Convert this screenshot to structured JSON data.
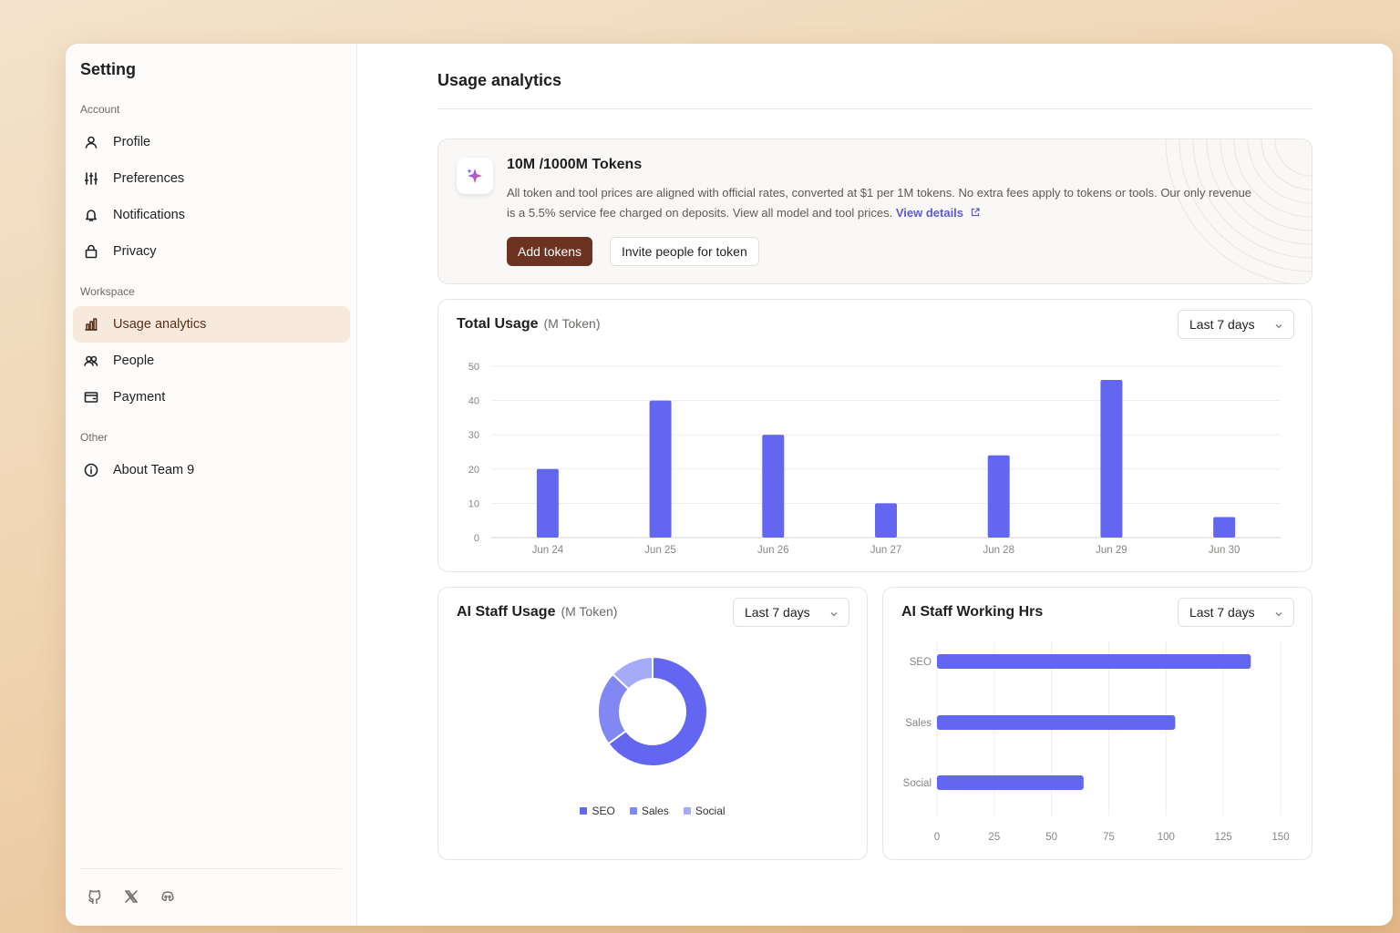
{
  "sidebar": {
    "title": "Setting",
    "sections": {
      "account": "Account",
      "workspace": "Workspace",
      "other": "Other"
    },
    "items": {
      "profile": "Profile",
      "preferences": "Preferences",
      "notifications": "Notifications",
      "privacy": "Privacy",
      "usage": "Usage analytics",
      "people": "People",
      "payment": "Payment",
      "about": "About Team 9"
    },
    "active_item": "Usage analytics",
    "social_icons": [
      "github-icon",
      "x-icon",
      "discord-icon"
    ]
  },
  "main": {
    "title": "Usage analytics",
    "token_card": {
      "title": "10M /1000M Tokens",
      "description": "All token and tool prices are aligned with official rates, converted at $1 per 1M tokens. No extra fees apply to tokens or tools. Our only revenue is a 5.5% service fee charged on deposits. View all model and tool prices.",
      "link": "View details",
      "add_button": "Add tokens",
      "invite_button": "Invite people for token"
    },
    "total_usage": {
      "title": "Total Usage",
      "unit": "(M Token)",
      "range": "Last 7 days"
    },
    "staff_usage": {
      "title": "AI Staff Usage",
      "unit": "(M Token)",
      "range": "Last 7 days"
    },
    "staff_hours": {
      "title": "AI Staff Working Hrs",
      "range": "Last 7 days"
    }
  },
  "colors": {
    "accent": "#6366f1",
    "primary_button": "#6b3320",
    "active_nav": "#f7eadc",
    "seo": "#6366f1",
    "sales": "#8187f3",
    "social": "#a5abf7"
  },
  "chart_data": [
    {
      "type": "bar",
      "title": "Total Usage",
      "categories": [
        "Jun 24",
        "Jun 25",
        "Jun 26",
        "Jun 27",
        "Jun 28",
        "Jun 29",
        "Jun 30"
      ],
      "values": [
        20,
        40,
        30,
        10,
        24,
        46,
        6
      ],
      "ylim": [
        0,
        50
      ],
      "yticks": [
        0,
        10,
        20,
        30,
        40,
        50
      ],
      "grid": true
    },
    {
      "type": "pie",
      "title": "AI Staff Usage",
      "donut": true,
      "categories": [
        "SEO",
        "Sales",
        "Social"
      ],
      "values": [
        65,
        22,
        13
      ],
      "legend": "bottom"
    },
    {
      "type": "bar",
      "orientation": "horizontal",
      "title": "AI Staff Working Hrs",
      "categories": [
        "SEO",
        "Sales",
        "Social"
      ],
      "values": [
        137,
        104,
        64
      ],
      "xlim": [
        0,
        150
      ],
      "xticks": [
        0,
        25,
        50,
        75,
        100,
        125,
        150
      ],
      "grid": true
    }
  ]
}
